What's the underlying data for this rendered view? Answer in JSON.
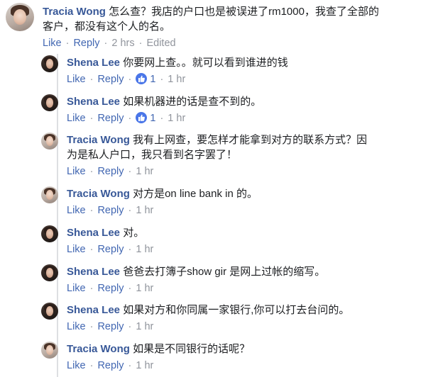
{
  "top_comment": {
    "author": "Tracia Wong",
    "text_line1": "怎么查？我店的户口也是被误进了rm1000，我查了全部的",
    "text_line2": "客户，都没有这个人的名。",
    "like": "Like",
    "reply": "Reply",
    "time": "2 hrs",
    "edited": "Edited"
  },
  "replies": [
    {
      "author": "Shena Lee",
      "text": "你要网上查。。就可以看到谁进的钱",
      "like": "Like",
      "reply": "Reply",
      "reaction_count": "1",
      "time": "1 hr"
    },
    {
      "author": "Shena Lee",
      "text": "如果机器进的话是查不到的。",
      "like": "Like",
      "reply": "Reply",
      "reaction_count": "1",
      "time": "1 hr"
    },
    {
      "author": "Tracia Wong",
      "text": "我有上网查，要怎样才能拿到对方的联系方式？因",
      "text2": "为是私人户口，我只看到名字罢了！",
      "like": "Like",
      "reply": "Reply",
      "time": "1 hr"
    },
    {
      "author": "Tracia Wong",
      "text": "对方是on line bank in 的。",
      "like": "Like",
      "reply": "Reply",
      "time": "1 hr"
    },
    {
      "author": "Shena Lee",
      "text": "对。",
      "like": "Like",
      "reply": "Reply",
      "time": "1 hr"
    },
    {
      "author": "Shena Lee",
      "text": "爸爸去打簿子show gir 是网上过帐的缩写。",
      "like": "Like",
      "reply": "Reply",
      "time": "1 hr"
    },
    {
      "author": "Shena Lee",
      "text": "如果对方和你同属一家银行,你可以打去台问的。",
      "like": "Like",
      "reply": "Reply",
      "time": "1 hr"
    },
    {
      "author": "Tracia Wong",
      "text": "如果是不同银行的话呢？",
      "like": "Like",
      "reply": "Reply",
      "time": "1 hr"
    }
  ],
  "colors": {
    "name": "#385898",
    "link": "#4267b2",
    "meta": "#90949c",
    "like_badge": "#4a76e8"
  }
}
